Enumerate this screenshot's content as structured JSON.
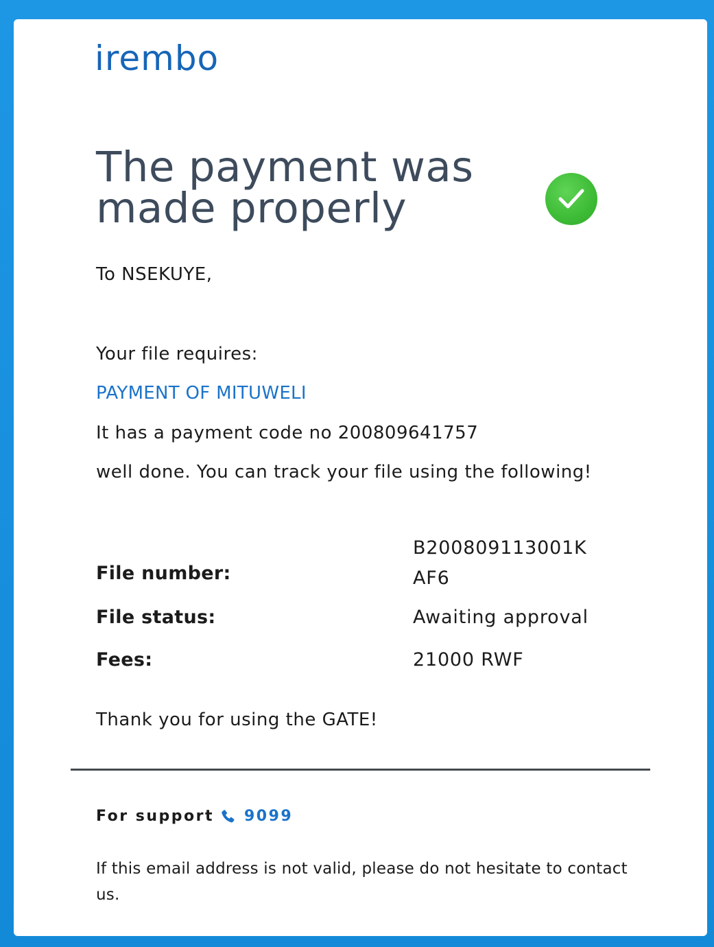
{
  "brand": {
    "logo_text": "irembo",
    "accent_color": "#1a73c9",
    "frame_color": "#1a90df",
    "success_color": "#3dbb36"
  },
  "heading": {
    "title": "The payment was made properly",
    "status_icon": "check-circle-icon"
  },
  "body": {
    "greeting": "To NSEKUYE,",
    "requires_label": "Your file requires:",
    "service_name": "PAYMENT OF MITUWELI",
    "payment_code_line": "It has a payment code no 200809641757",
    "track_line": "well done. You can track your file using the following!"
  },
  "details": {
    "file_number_label": "File number:",
    "file_number_value_line1": "B200809113001K",
    "file_number_value_line2": "AF6",
    "file_status_label": "File status:",
    "file_status_value": "Awaiting approval",
    "fees_label": "Fees:",
    "fees_value": "21000 RWF"
  },
  "closing": {
    "thanks": "Thank you for using the GATE!"
  },
  "footer": {
    "support_label": "For support",
    "support_icon": "phone-icon",
    "support_number": "9099",
    "notice": "If this email address is not valid, please do not hesitate to contact us."
  }
}
